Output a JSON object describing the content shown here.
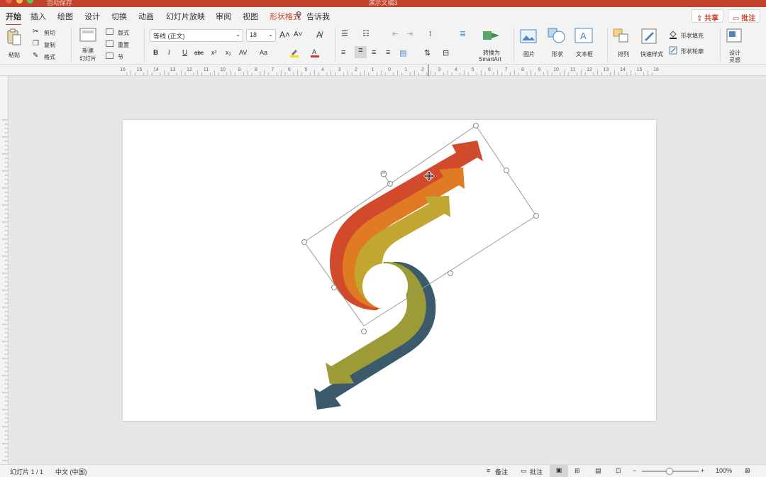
{
  "window": {
    "title": "演示文稿3",
    "autosave_label": "自动保存"
  },
  "tabs": [
    "开始",
    "插入",
    "绘图",
    "设计",
    "切换",
    "动画",
    "幻灯片放映",
    "审阅",
    "视图",
    "形状格式",
    "告诉我"
  ],
  "header_buttons": {
    "share": "共享",
    "comment": "批注"
  },
  "ribbon": {
    "clipboard": {
      "paste": "粘贴",
      "cut": "剪切",
      "copy": "复制",
      "format": "格式"
    },
    "slides": {
      "new_slide_line1": "新建",
      "new_slide_line2": "幻灯片",
      "layout": "版式",
      "reset": "重置",
      "section": "节"
    },
    "font": {
      "name": "等线 (正文)",
      "size": "18"
    },
    "format_buttons": [
      "B",
      "I",
      "U",
      "abc",
      "x²",
      "x₂",
      "AV",
      "Aa"
    ],
    "convert_smartart_line1": "转换为",
    "convert_smartart_line2": "SmartArt",
    "insert": {
      "picture": "图片",
      "shape": "形状",
      "textbox": "文本框"
    },
    "arrange": "排列",
    "quick_styles": "快速样式",
    "shape_fill": "形状填充",
    "shape_outline": "形状轮廓",
    "design_ideas_line1": "设计",
    "design_ideas_line2": "灵感"
  },
  "ruler_numbers": [
    "16",
    "15",
    "14",
    "13",
    "12",
    "11",
    "10",
    "9",
    "8",
    "7",
    "6",
    "5",
    "4",
    "3",
    "2",
    "1",
    "0",
    "1",
    "2",
    "3",
    "4",
    "5",
    "6",
    "7",
    "8",
    "9",
    "10",
    "11",
    "12",
    "13",
    "14",
    "15",
    "16"
  ],
  "status": {
    "slide_info": "幻灯片 1 / 1",
    "language": "中文 (中国)",
    "notes": "备注",
    "comments": "批注",
    "zoom": "100%"
  },
  "colors": {
    "accent": "#c4402a",
    "arrow_red": "#d04a2b",
    "arrow_orange": "#e07a23",
    "arrow_gold": "#c1a632",
    "arrow_olive": "#9c9b36",
    "arrow_teal": "#3b5a6b"
  }
}
